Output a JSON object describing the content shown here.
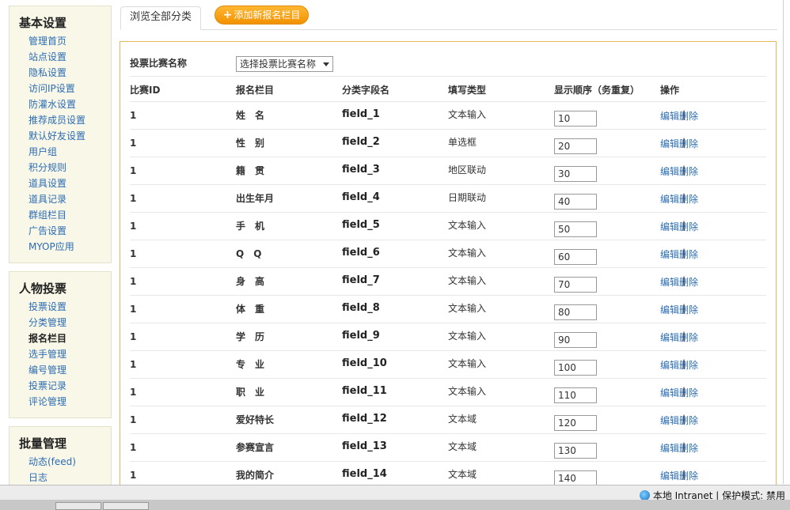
{
  "sidebar": {
    "sections": [
      {
        "title": "基本设置",
        "items": [
          "管理首页",
          "站点设置",
          "隐私设置",
          "访问IP设置",
          "防灌水设置",
          "推荐成员设置",
          "默认好友设置",
          "用户组",
          "积分规则",
          "道具设置",
          "道具记录",
          "群组栏目",
          "广告设置",
          "MYOP应用"
        ]
      },
      {
        "title": "人物投票",
        "items": [
          "投票设置",
          "分类管理",
          "报名栏目",
          "选手管理",
          "编号管理",
          "投票记录",
          "评论管理"
        ],
        "active": "报名栏目"
      },
      {
        "title": "批量管理",
        "items": [
          "动态(feed)",
          "日志"
        ]
      }
    ]
  },
  "tabs": {
    "current": "浏览全部分类",
    "add_button": "添加新报名栏目"
  },
  "filter": {
    "label": "投票比赛名称",
    "select_value": "选择投票比赛名称"
  },
  "table": {
    "headers": [
      "比赛ID",
      "报名栏目",
      "分类字段名",
      "填写类型",
      "显示顺序（务重复）",
      "操作"
    ],
    "rows": [
      {
        "id": "1",
        "name": "姓　名",
        "field": "field_1",
        "type": "文本输入",
        "order": "10"
      },
      {
        "id": "1",
        "name": "性　别",
        "field": "field_2",
        "type": "单选框",
        "order": "20"
      },
      {
        "id": "1",
        "name": "籍　贯",
        "field": "field_3",
        "type": "地区联动",
        "order": "30"
      },
      {
        "id": "1",
        "name": "出生年月",
        "field": "field_4",
        "type": "日期联动",
        "order": "40"
      },
      {
        "id": "1",
        "name": "手　机",
        "field": "field_5",
        "type": "文本输入",
        "order": "50"
      },
      {
        "id": "1",
        "name": "Q　Q",
        "field": "field_6",
        "type": "文本输入",
        "order": "60"
      },
      {
        "id": "1",
        "name": "身　高",
        "field": "field_7",
        "type": "文本输入",
        "order": "70"
      },
      {
        "id": "1",
        "name": "体　重",
        "field": "field_8",
        "type": "文本输入",
        "order": "80"
      },
      {
        "id": "1",
        "name": "学　历",
        "field": "field_9",
        "type": "文本输入",
        "order": "90"
      },
      {
        "id": "1",
        "name": "专　业",
        "field": "field_10",
        "type": "文本输入",
        "order": "100"
      },
      {
        "id": "1",
        "name": "职　业",
        "field": "field_11",
        "type": "文本输入",
        "order": "110"
      },
      {
        "id": "1",
        "name": "爱好特长",
        "field": "field_12",
        "type": "文本域",
        "order": "120"
      },
      {
        "id": "1",
        "name": "参赛宣言",
        "field": "field_13",
        "type": "文本域",
        "order": "130"
      },
      {
        "id": "1",
        "name": "我的简介",
        "field": "field_14",
        "type": "文本域",
        "order": "140"
      }
    ],
    "edit_label": "编辑",
    "delete_label": "删除",
    "separator": "|"
  },
  "statusbar": {
    "zone_text": "本地 Intranet | 保护模式: 禁用"
  },
  "colors": {
    "link": "#2b6cb2",
    "accent_button": "#f29200",
    "panel_border": "#e6b85c",
    "sidebar_bg": "#f8f7e8"
  }
}
